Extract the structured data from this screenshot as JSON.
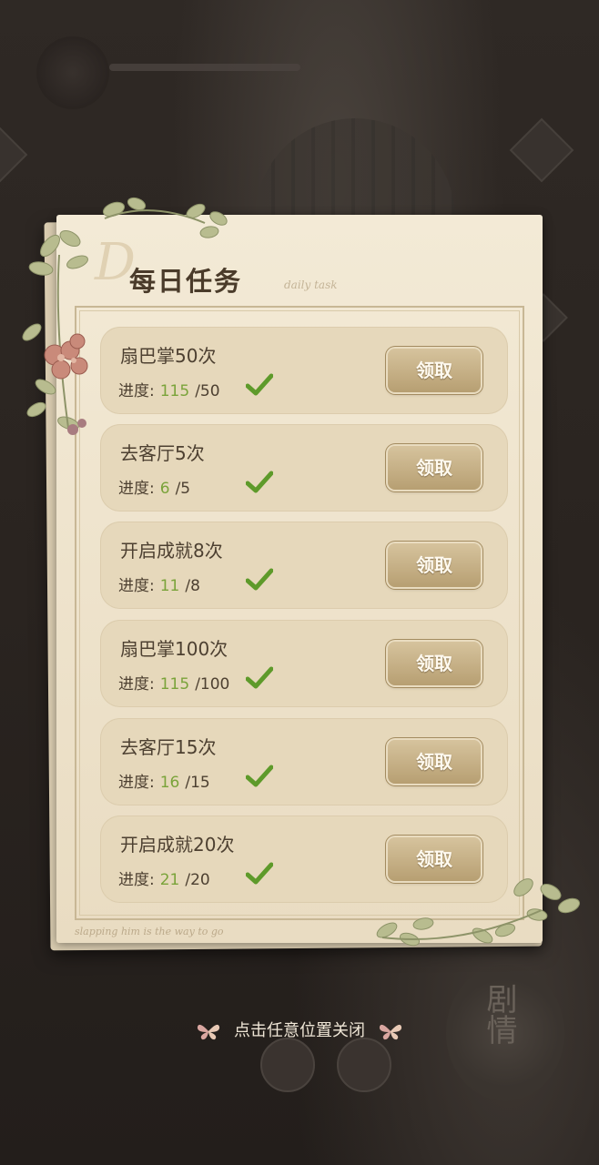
{
  "dialog": {
    "title": "每日任务",
    "title_deco": "D",
    "title_sub": "daily task",
    "bottom_script": "slapping him is the way to go",
    "close_hint": "点击任意位置关闭"
  },
  "tasks": [
    {
      "name": "扇巴掌50次",
      "progress_label": "进度:",
      "current": "115",
      "total": "/50",
      "completed": true,
      "button": "领取"
    },
    {
      "name": "去客厅5次",
      "progress_label": "进度:",
      "current": "6",
      "total": "/5",
      "completed": true,
      "button": "领取"
    },
    {
      "name": "开启成就8次",
      "progress_label": "进度:",
      "current": "11",
      "total": "/8",
      "completed": true,
      "button": "领取"
    },
    {
      "name": "扇巴掌100次",
      "progress_label": "进度:",
      "current": "115",
      "total": "/100",
      "completed": true,
      "button": "领取"
    },
    {
      "name": "去客厅15次",
      "progress_label": "进度:",
      "current": "16",
      "total": "/15",
      "completed": true,
      "button": "领取"
    },
    {
      "name": "开启成就20次",
      "progress_label": "进度:",
      "current": "21",
      "total": "/20",
      "completed": true,
      "button": "领取"
    }
  ],
  "background": {
    "story_label": "剧情"
  },
  "colors": {
    "progress_current": "#7aa33a",
    "check": "#5e9a2a",
    "button": "#c7b187",
    "paper": "#f0e6d0"
  },
  "icons": {
    "check": "check-icon",
    "butterfly": "butterfly-icon"
  }
}
